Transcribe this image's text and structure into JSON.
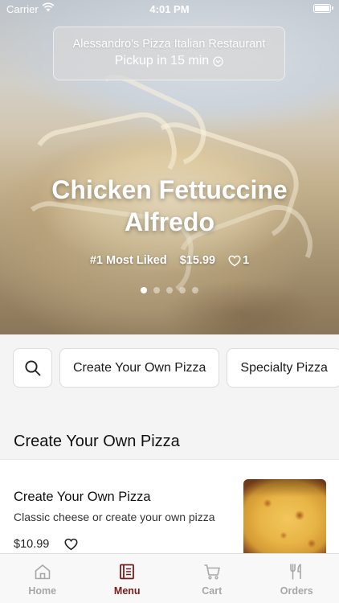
{
  "status": {
    "carrier": "Carrier",
    "time": "4:01 PM"
  },
  "header": {
    "restaurant_name": "Alessandro's Pizza Italian Restaurant",
    "pickup_label": "Pickup in 15 min"
  },
  "featured": {
    "title": "Chicken Fettuccine Alfredo",
    "rank": "#1 Most Liked",
    "price": "$15.99",
    "likes": "1",
    "slides_total": 5,
    "active_slide": 1
  },
  "categories": {
    "search_icon": "search-icon",
    "items": [
      "Create Your Own Pizza",
      "Specialty Pizza"
    ]
  },
  "section": {
    "title": "Create Your Own Pizza",
    "items": [
      {
        "name": "Create Your Own Pizza",
        "description": "Classic cheese or create your own pizza",
        "price": "$10.99",
        "fav_icon": "heart-outline-icon"
      }
    ]
  },
  "tabs": [
    {
      "label": "Home",
      "icon": "home-icon",
      "active": false
    },
    {
      "label": "Menu",
      "icon": "menu-book-icon",
      "active": true
    },
    {
      "label": "Cart",
      "icon": "cart-icon",
      "active": false
    },
    {
      "label": "Orders",
      "icon": "utensils-icon",
      "active": false
    }
  ],
  "colors": {
    "accent": "#7a1c1c",
    "inactive_tab": "#a7a7a7"
  }
}
